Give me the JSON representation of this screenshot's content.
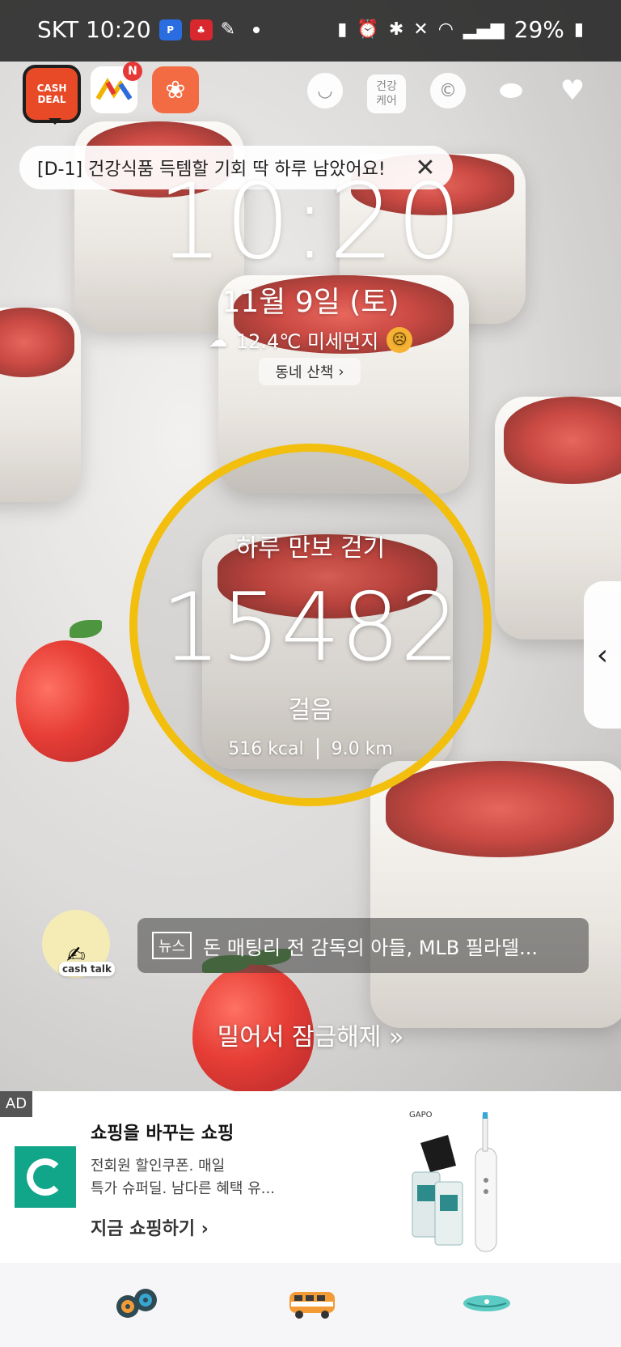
{
  "status_bar": {
    "carrier_time": "SKT 10:20",
    "battery": "29%",
    "app_icons": [
      "finance-app-icon",
      "lottery-app-icon",
      "feather-app-icon"
    ]
  },
  "top_icons": {
    "cash_deal": "CASH\nDEAL",
    "health_care": "건강\n케어",
    "sale_badge": "N"
  },
  "banner": {
    "text": "[D-1] 건강식품 득템할 기회 딱 하루 남았어요!"
  },
  "lock": {
    "time": "10:20",
    "date": "11월 9일 (토)",
    "weather_text": "12.4℃ 미세먼지",
    "walk_button": "동네 산책"
  },
  "steps": {
    "title": "하루 만보 걷기",
    "count": "15482",
    "unit": "걸음",
    "kcal": "516 kcal",
    "km": "9.0 km",
    "ring_color": "#f2bf0f"
  },
  "news": {
    "tag": "뉴스",
    "headline": "돈 매팅리 전 감독의 아들, MLB 필라델..."
  },
  "unlock": {
    "text": "밀어서 잠금해제 »"
  },
  "ad": {
    "label": "AD",
    "title": "쇼핑을 바꾸는 쇼핑",
    "desc_line1": "전회원 할인쿠폰. 매일",
    "desc_line2": "특가 슈퍼딜. 남다른 혜택 유...",
    "cta": "지금 쇼핑하기",
    "product_brand": "GAPO",
    "logo_color": "#11a58a"
  }
}
